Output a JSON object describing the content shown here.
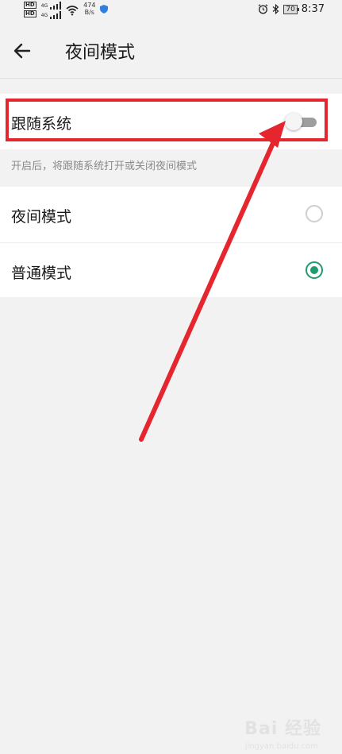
{
  "status_bar": {
    "sim_labels": [
      "HD",
      "HD"
    ],
    "signal_labels": [
      "4G",
      "4G"
    ],
    "net_speed_value": "474",
    "net_speed_unit": "B/s",
    "battery_level": "70",
    "time": "8:37"
  },
  "app_bar": {
    "title": "夜间模式"
  },
  "follow_system": {
    "label": "跟随系统",
    "enabled": false,
    "hint": "开启后，将跟随系统打开或关闭夜间模式"
  },
  "modes": [
    {
      "label": "夜间模式",
      "selected": false
    },
    {
      "label": "普通模式",
      "selected": true
    }
  ],
  "colors": {
    "accent": "#1f9b6f",
    "annotation_red": "#e5262f"
  },
  "watermark": {
    "text": "Bai 经验",
    "sub": "jingyan.baidu.com"
  }
}
